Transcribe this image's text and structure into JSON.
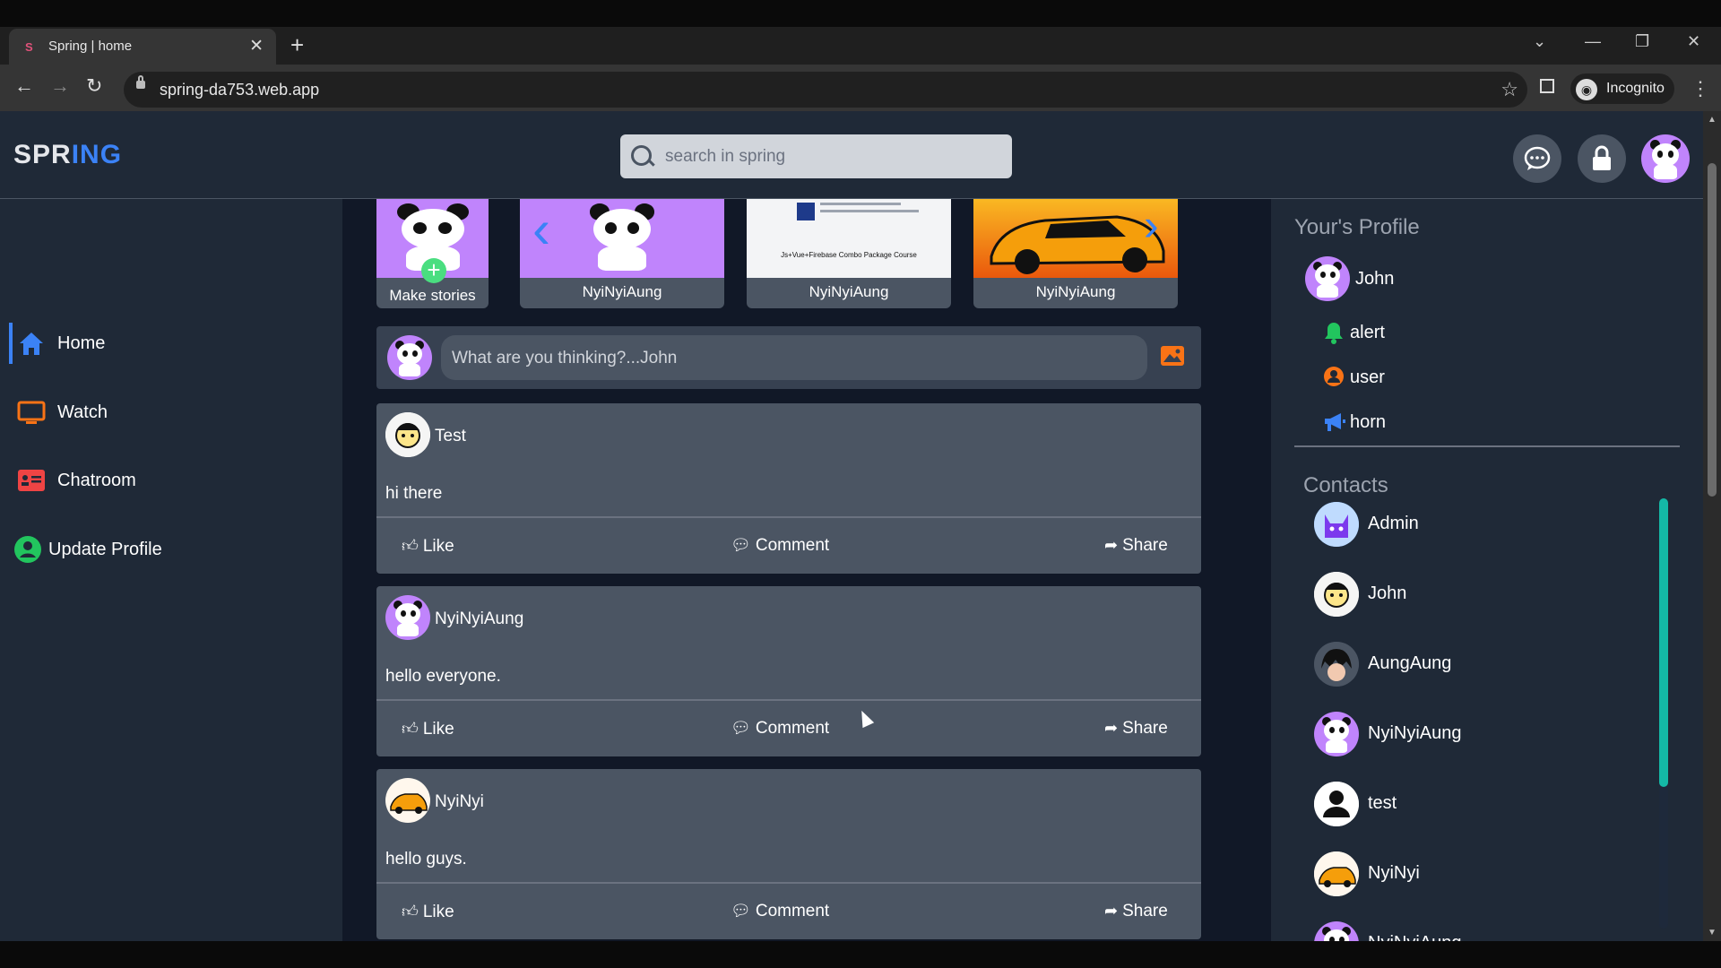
{
  "browser": {
    "tab_title": "Spring | home",
    "url": "spring-da753.web.app",
    "profile_label": "Incognito"
  },
  "app": {
    "logo_a": "SPR",
    "logo_b": "ING",
    "search_placeholder": "search in spring"
  },
  "sidebar": {
    "items": [
      {
        "label": "Home",
        "icon": "home-icon",
        "color": "#3b82f6"
      },
      {
        "label": "Watch",
        "icon": "tv-icon",
        "color": "#f97316"
      },
      {
        "label": "Chatroom",
        "icon": "chatroom-icon",
        "color": "#ef4444"
      },
      {
        "label": "Update Profile",
        "icon": "user-circle-icon",
        "color": "#22c55e"
      }
    ]
  },
  "stories": [
    {
      "label": "Make stories"
    },
    {
      "label": "NyiNyiAung"
    },
    {
      "label": "NyiNyiAung"
    },
    {
      "label": "NyiNyiAung"
    }
  ],
  "composer": {
    "placeholder": "What are you thinking?...John"
  },
  "post_actions": {
    "like": "Like",
    "comment": "Comment",
    "share": "Share"
  },
  "posts": [
    {
      "author": "Test",
      "text": "hi there"
    },
    {
      "author": "NyiNyiAung",
      "text": "hello everyone."
    },
    {
      "author": "NyiNyi",
      "text": "hello guys."
    }
  ],
  "profile_panel": {
    "heading": "Your's Profile",
    "name": "John",
    "items": [
      {
        "label": "alert",
        "icon": "bell-icon",
        "color": "#22c55e"
      },
      {
        "label": "user",
        "icon": "user-icon",
        "color": "#f97316"
      },
      {
        "label": "horn",
        "icon": "megaphone-icon",
        "color": "#3b82f6"
      }
    ]
  },
  "contacts": {
    "heading": "Contacts",
    "items": [
      {
        "name": "Admin"
      },
      {
        "name": "John"
      },
      {
        "name": "AungAung"
      },
      {
        "name": "NyiNyiAung"
      },
      {
        "name": "test"
      },
      {
        "name": "NyiNyi"
      },
      {
        "name": "NyiNyiAung"
      }
    ]
  },
  "story_thumb_text": "Js+Vue+Firebase Combo Package Course"
}
